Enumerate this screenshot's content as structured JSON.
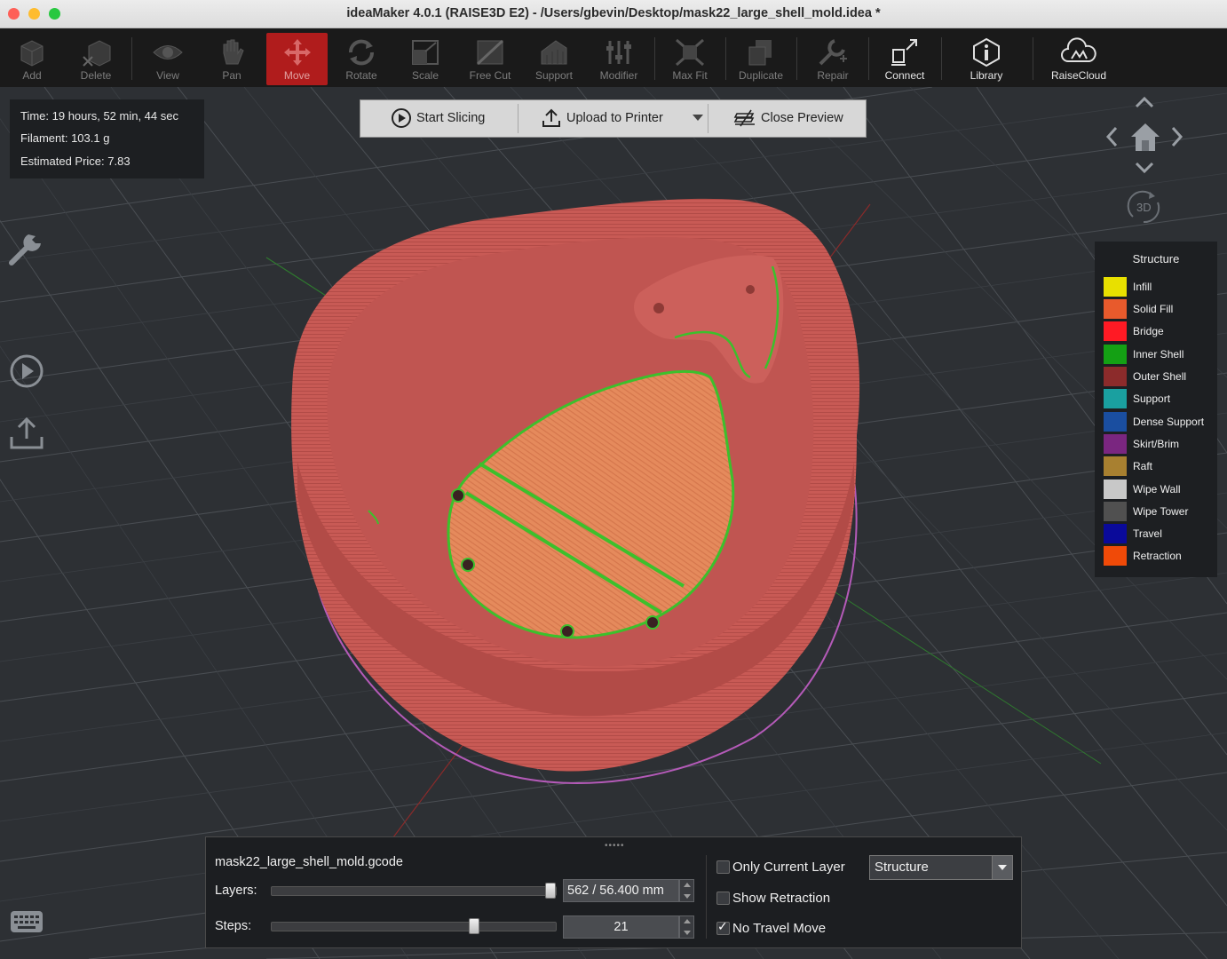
{
  "window": {
    "title": "ideaMaker 4.0.1 (RAISE3D E2) - /Users/gbevin/Desktop/mask22_large_shell_mold.idea *"
  },
  "toolbar": {
    "items": [
      {
        "label": "Add",
        "icon": "add-icon"
      },
      {
        "label": "Delete",
        "icon": "delete-icon"
      },
      {
        "label": "View",
        "icon": "eye-icon"
      },
      {
        "label": "Pan",
        "icon": "hand-icon"
      },
      {
        "label": "Move",
        "icon": "move-icon",
        "active": true
      },
      {
        "label": "Rotate",
        "icon": "rotate-icon"
      },
      {
        "label": "Scale",
        "icon": "scale-icon"
      },
      {
        "label": "Free Cut",
        "icon": "cut-icon"
      },
      {
        "label": "Support",
        "icon": "support-icon"
      },
      {
        "label": "Modifier",
        "icon": "modifier-icon"
      },
      {
        "label": "Max Fit",
        "icon": "maxfit-icon"
      },
      {
        "label": "Duplicate",
        "icon": "duplicate-icon"
      },
      {
        "label": "Repair",
        "icon": "repair-icon"
      },
      {
        "label": "Connect",
        "icon": "connect-icon"
      },
      {
        "label": "Library",
        "icon": "library-icon"
      },
      {
        "label": "RaiseCloud",
        "icon": "cloud-icon"
      }
    ],
    "active_color": "#b01c1c"
  },
  "info": {
    "time": "Time: 19 hours, 52 min, 44 sec",
    "filament": "Filament: 103.1 g",
    "price": "Estimated Price: 7.83"
  },
  "actions": {
    "start_slicing": "Start Slicing",
    "upload": "Upload to Printer",
    "close_preview": "Close Preview"
  },
  "navigation": {
    "mode_label": "3D"
  },
  "legend": {
    "title": "Structure",
    "items": [
      {
        "label": "Infill",
        "color": "#e8e000"
      },
      {
        "label": "Solid Fill",
        "color": "#e85a2c"
      },
      {
        "label": "Bridge",
        "color": "#ff1a24"
      },
      {
        "label": "Inner Shell",
        "color": "#14a014"
      },
      {
        "label": "Outer Shell",
        "color": "#8c2b2b"
      },
      {
        "label": "Support",
        "color": "#1aa0a0"
      },
      {
        "label": "Dense Support",
        "color": "#1a4ea0"
      },
      {
        "label": "Skirt/Brim",
        "color": "#7a2680"
      },
      {
        "label": "Raft",
        "color": "#a88030"
      },
      {
        "label": "Wipe Wall",
        "color": "#c8c8c8"
      },
      {
        "label": "Wipe Tower",
        "color": "#505050"
      },
      {
        "label": "Travel",
        "color": "#0a0a9a"
      },
      {
        "label": "Retraction",
        "color": "#f04a08"
      }
    ]
  },
  "preview_panel": {
    "filename": "mask22_large_shell_mold.gcode",
    "layers_label": "Layers:",
    "layers_value": "562 / 56.400 mm",
    "layers_fraction": 1.0,
    "steps_label": "Steps:",
    "steps_value": "21",
    "steps_fraction": 0.72,
    "only_current_layer": {
      "label": "Only Current Layer",
      "checked": false
    },
    "show_retraction": {
      "label": "Show Retraction",
      "checked": false
    },
    "no_travel_move": {
      "label": "No Travel Move",
      "checked": true
    },
    "view_mode": "Structure"
  },
  "model_colors": {
    "outer_shell": "#c85a55",
    "top_fill": "#e58a5c",
    "inner_shell": "#3cc02c",
    "skirt": "#b45ab8"
  }
}
